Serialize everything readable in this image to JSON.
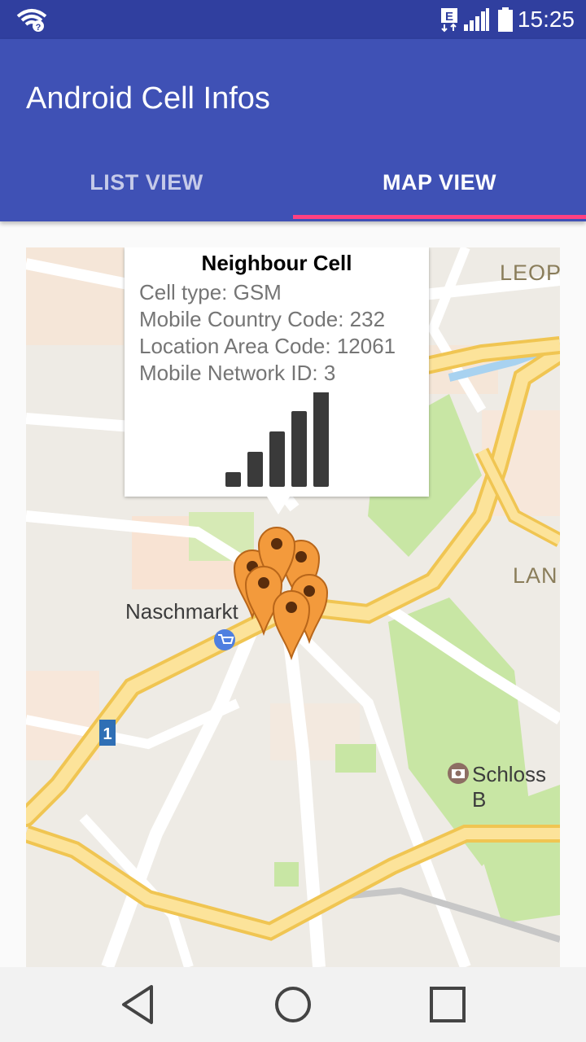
{
  "status_bar": {
    "time": "15:25",
    "network_badge": "E",
    "icons": [
      "wifi-question-icon",
      "data-e-icon",
      "signal-icon",
      "battery-icon"
    ]
  },
  "app_bar": {
    "title": "Android Cell Infos",
    "background_color": "#3f51b5",
    "status_color": "#303f9f",
    "accent_color": "#ff4081"
  },
  "tabs": [
    {
      "label": "LIST VIEW",
      "selected": false
    },
    {
      "label": "MAP VIEW",
      "selected": true
    }
  ],
  "map": {
    "labels": {
      "leop": "LEOP",
      "lan": "LAN",
      "naschmarkt": "Naschmarkt",
      "schloss": "Schloss B",
      "route_number": "1"
    },
    "marker_color": "#f39a3c",
    "marker_count": 6
  },
  "info_window": {
    "title": "Neighbour Cell",
    "lines": [
      "Cell type: GSM",
      "Mobile Country Code: 232",
      "Location Area Code: 12061",
      "Mobile Network ID: 3"
    ],
    "signal_bars_filled": 5,
    "signal_bars_total": 5
  },
  "nav_bar": {
    "icons": [
      "back-icon",
      "home-icon",
      "recents-icon"
    ]
  }
}
